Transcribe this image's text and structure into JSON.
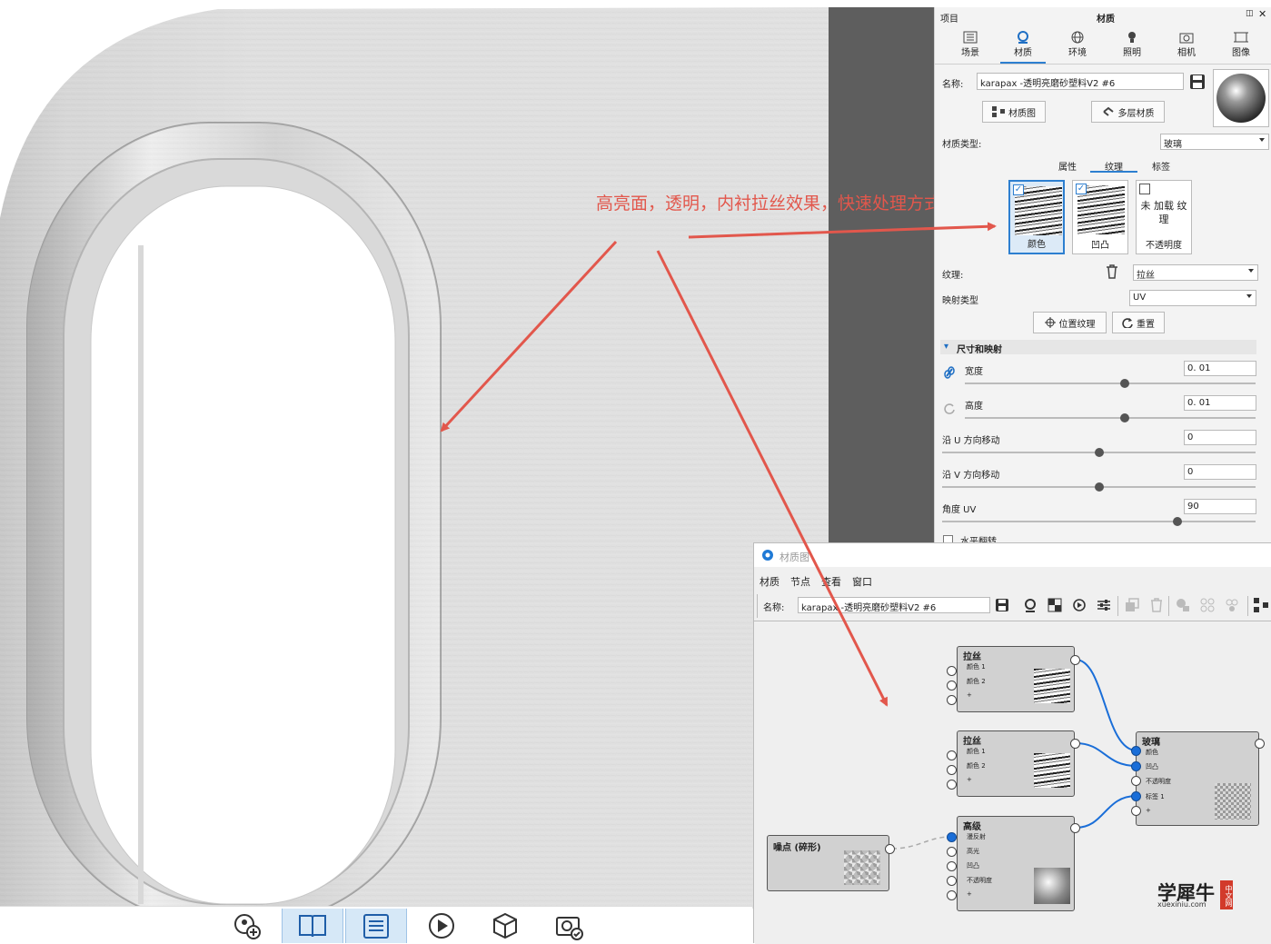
{
  "annotation": {
    "text": "高亮面，透明，内衬拉丝效果，快速处理方式",
    "color": "#e2574c"
  },
  "panel": {
    "header_left": "项目",
    "header_title": "材质",
    "tabs": [
      {
        "label": "场景",
        "icon": "scene-tree-icon"
      },
      {
        "label": "材质",
        "icon": "material-ball-icon"
      },
      {
        "label": "环境",
        "icon": "globe-icon"
      },
      {
        "label": "照明",
        "icon": "light-bulb-icon"
      },
      {
        "label": "相机",
        "icon": "camera-icon"
      },
      {
        "label": "图像",
        "icon": "image-frame-icon"
      }
    ],
    "name_label": "名称:",
    "name_value": "karapax -透明亮磨砂塑料V2 #6",
    "material_graph_button": "材质图",
    "multi_layer_button": "多层材质",
    "material_type_label": "材质类型:",
    "material_type_value": "玻璃",
    "subtabs": [
      "属性",
      "纹理",
      "标签"
    ],
    "texture_slots": [
      {
        "label": "颜色",
        "checked": true
      },
      {
        "label": "凹凸",
        "checked": true
      },
      {
        "label": "不透明度",
        "checked": false,
        "empty_text": "未 加载 纹 理"
      }
    ],
    "texture_label": "纹理:",
    "texture_value": "拉丝",
    "mapping_label": "映射类型",
    "mapping_value": "UV",
    "position_texture_button": "位置纹理",
    "reset_button": "重置",
    "section_title": "尺寸和映射",
    "params": [
      {
        "label": "宽度",
        "value": "0. 01",
        "level": 0.55
      },
      {
        "label": "高度",
        "value": "0. 01",
        "level": 0.55
      },
      {
        "label": "沿 U 方向移动",
        "value": "0",
        "level": 0.5
      },
      {
        "label": "沿 V 方向移动",
        "value": "0",
        "level": 0.5
      },
      {
        "label": "角度 UV",
        "value": "90",
        "level": 0.75
      }
    ],
    "flip_label": "水平翻转"
  },
  "graph": {
    "title": "材质图",
    "menu": [
      "材质",
      "节点",
      "查看",
      "窗口"
    ],
    "name_label": "名称:",
    "name_value": "karapax -透明亮磨砂塑料V2 #6",
    "nodes": {
      "brushed1": {
        "title": "拉丝",
        "ports": [
          "颜色 1",
          "颜色 2",
          "+"
        ]
      },
      "brushed2": {
        "title": "拉丝",
        "ports": [
          "颜色 1",
          "颜色 2",
          "+"
        ]
      },
      "glass": {
        "title": "玻璃",
        "ports": [
          "颜色",
          "凹凸",
          "不透明度",
          "标签 1",
          "+"
        ]
      },
      "advanced": {
        "title": "高级",
        "ports": [
          "漫反射",
          "高光",
          "凹凸",
          "不透明度",
          "+"
        ]
      },
      "noise": {
        "title": "噪点 (碎形)"
      }
    }
  },
  "watermark": {
    "main": "学犀牛",
    "url": "xuexiniu.com",
    "badge": "中文网"
  }
}
